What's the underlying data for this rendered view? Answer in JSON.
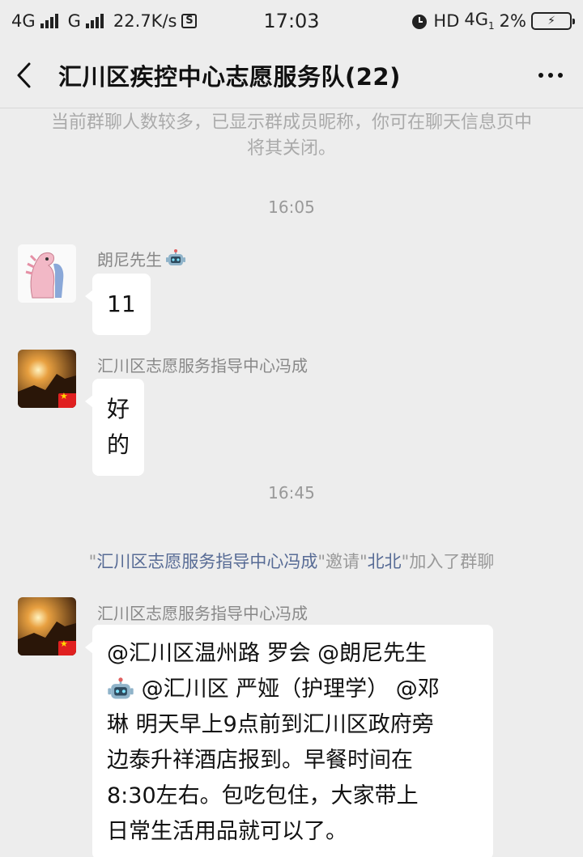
{
  "status_bar": {
    "network1": "4G",
    "network2": "G",
    "speed": "22.7K/s",
    "sim_icon": "S",
    "time": "17:03",
    "hd": "HD",
    "net_right": "4G",
    "net_right_sub": "1",
    "battery_pct": "2%"
  },
  "nav": {
    "title": "汇川区疾控中心志愿服务队(22)"
  },
  "chat": {
    "notice": "当前群聊人数较多，已显示群成员昵称，你可在聊天信息页中将其关闭。",
    "time1": "16:05",
    "time2": "16:45",
    "msg1": {
      "sender": "朗尼先生",
      "text": "11"
    },
    "msg2": {
      "sender": "汇川区志愿服务指导中心冯成",
      "text": "好的"
    },
    "system": {
      "q1": "\"",
      "inviter": "汇川区志愿服务指导中心冯成",
      "q2": "\"邀请\"",
      "invitee": "北北",
      "q3": "\"加入了群聊"
    },
    "msg3": {
      "sender": "汇川区志愿服务指导中心冯成",
      "line1": "@汇川区温州路 罗会 @朗尼先生",
      "line2": " @汇川区 严娅（护理学） @邓",
      "line3": "琳 明天早上9点前到汇川区政府旁",
      "line4": "边泰升祥酒店报到。早餐时间在",
      "line5": "8:30左右。包吃包住，大家带上",
      "line6": "日常生活用品就可以了。"
    }
  },
  "colors": {
    "background": "#ededed",
    "bubble": "#ffffff",
    "link": "#576b95",
    "muted": "#999999"
  }
}
